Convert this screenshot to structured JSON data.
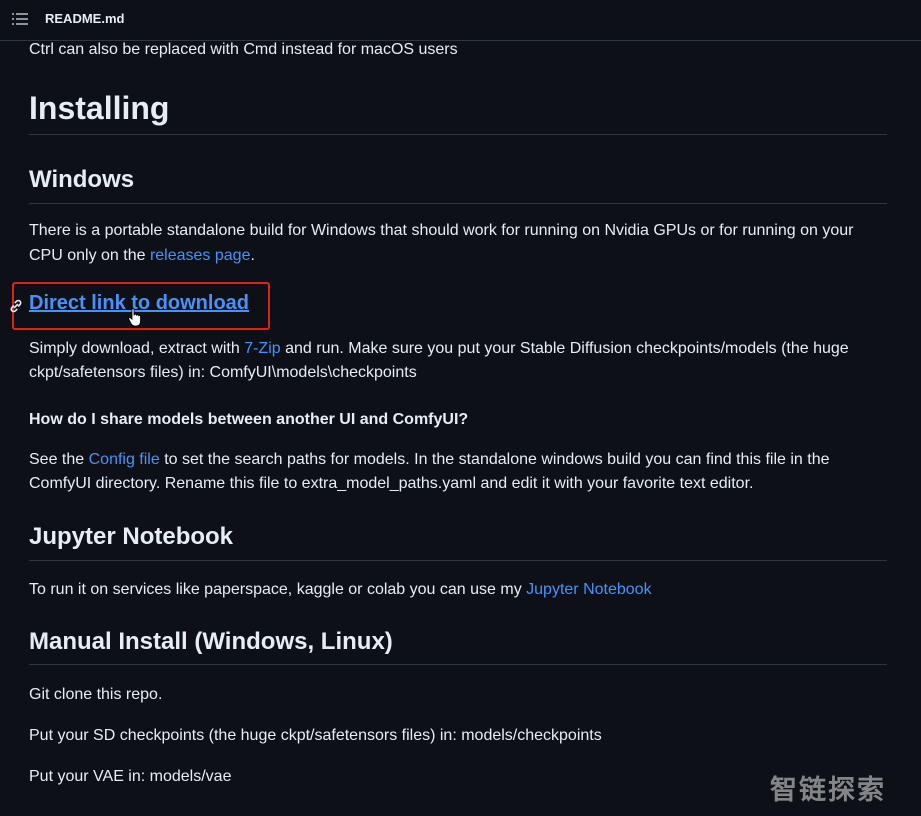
{
  "header": {
    "file_name": "README.md",
    "menu_icon": "list-icon"
  },
  "content": {
    "intro_line": "Ctrl can also be replaced with Cmd instead for macOS users",
    "heading_installing": "Installing",
    "heading_windows": "Windows",
    "windows_text_1": "There is a portable standalone build for Windows that should work for running on Nvidia GPUs or for running on your",
    "windows_text_2_before": "CPU only on the ",
    "windows_text_2_link": "releases page",
    "windows_text_2_after": ".",
    "direct_link": "Direct link to download",
    "anchor_icon": "link-icon",
    "download_text_1_before": "Simply download, extract with ",
    "download_text_1_link": "7-Zip",
    "download_text_1_after": " and run. Make sure you put your Stable Diffusion checkpoints/models (the huge",
    "download_text_2": "ckpt/safetensors files) in: ComfyUI\\models\\checkpoints",
    "heading_share_models": "How do I share models between another UI and ComfyUI?",
    "share_text_1_before": "See the ",
    "share_text_1_link": "Config file",
    "share_text_1_after": " to set the search paths for models. In the standalone windows build you can find this file in the",
    "share_text_2": "ComfyUI directory. Rename this file to extra_model_paths.yaml and edit it with your favorite text editor.",
    "heading_jupyter": "Jupyter Notebook",
    "jupyter_text_before": "To run it on services like paperspace, kaggle or colab you can use my ",
    "jupyter_text_link": "Jupyter Notebook",
    "heading_manual": "Manual Install (Windows, Linux)",
    "manual_line_1": "Git clone this repo.",
    "manual_line_2": "Put your SD checkpoints (the huge ckpt/safetensors files) in: models/checkpoints",
    "manual_line_3": "Put your VAE in: models/vae"
  },
  "overlay": {
    "watermark": "智链探索",
    "highlight_color": "#e0201b",
    "link_color": "#4493f8",
    "background_color": "#0d1117"
  }
}
